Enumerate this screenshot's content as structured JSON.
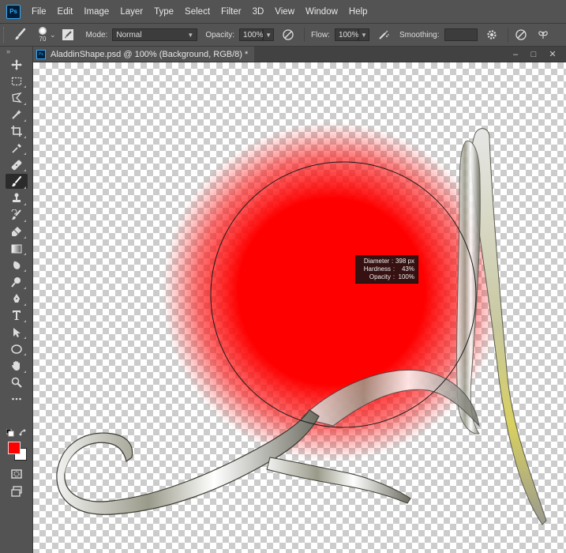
{
  "app": {
    "logo_text": "Ps"
  },
  "menu": [
    "File",
    "Edit",
    "Image",
    "Layer",
    "Type",
    "Select",
    "Filter",
    "3D",
    "View",
    "Window",
    "Help"
  ],
  "options": {
    "brush_size": "70",
    "mode_label": "Mode:",
    "mode_value": "Normal",
    "opacity_label": "Opacity:",
    "opacity_value": "100%",
    "flow_label": "Flow:",
    "flow_value": "100%",
    "smoothing_label": "Smoothing:",
    "smoothing_value": ""
  },
  "document": {
    "tab_title": "AladdinShape.psd @ 100% (Background, RGB/8) *"
  },
  "brush_hud": {
    "diameter_label": "Diameter",
    "diameter_value": "398 px",
    "hardness_label": "Hardness",
    "hardness_value": "43%",
    "opacity_label": "Opacity",
    "opacity_value": "100%"
  },
  "colors": {
    "foreground": "#ff0000",
    "background": "#ffffff"
  },
  "tools": [
    "move-icon",
    "marquee-icon",
    "lasso-icon",
    "quick-select-icon",
    "crop-icon",
    "eyedropper-icon",
    "healing-icon",
    "brush-icon",
    "stamp-icon",
    "history-brush-icon",
    "eraser-icon",
    "gradient-icon",
    "blur-icon",
    "dodge-icon",
    "pen-icon",
    "type-icon",
    "path-select-icon",
    "ellipse-icon",
    "hand-icon",
    "zoom-icon",
    "more-icon"
  ]
}
